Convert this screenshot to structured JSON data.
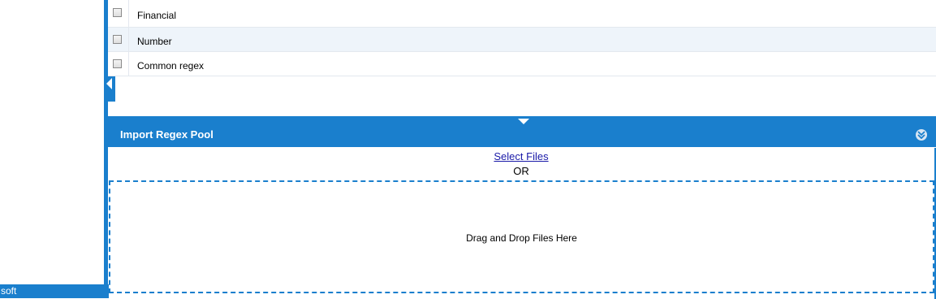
{
  "left_panel": {
    "footer_text": "soft"
  },
  "regex_list": {
    "items": [
      {
        "label": "Financial",
        "checked": false
      },
      {
        "label": "Number",
        "checked": false
      },
      {
        "label": "Common regex",
        "checked": false
      }
    ]
  },
  "import_panel": {
    "title": "Import Regex Pool",
    "select_files_label": "Select Files",
    "or_text": "OR",
    "drop_zone_text": "Drag and Drop Files Here"
  },
  "icons": {
    "collapse_left": "triangle-left-icon",
    "splitter": "triangle-down-icon",
    "panel_toggle": "double-chevron-down-icon"
  },
  "colors": {
    "accent": "#1a7fcd",
    "row_alt": "#eef4fa",
    "link": "#1a1aa8"
  }
}
